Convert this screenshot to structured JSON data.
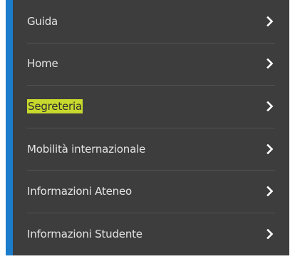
{
  "menu": {
    "accent_color": "#1c7ccc",
    "background_color": "#3d3d3d",
    "highlight_color": "#c7d92d",
    "items": [
      {
        "label": "Guida",
        "icon": "chevron-right-icon"
      },
      {
        "label": "Home",
        "icon": "chevron-right-icon"
      },
      {
        "label": "Segreteria",
        "icon": "chevron-right-icon",
        "highlighted": true
      },
      {
        "label": "Mobilità internazionale",
        "icon": "chevron-right-icon"
      },
      {
        "label": "Informazioni Ateneo",
        "icon": "chevron-right-icon"
      },
      {
        "label": "Informazioni Studente",
        "icon": "chevron-right-icon"
      }
    ]
  }
}
